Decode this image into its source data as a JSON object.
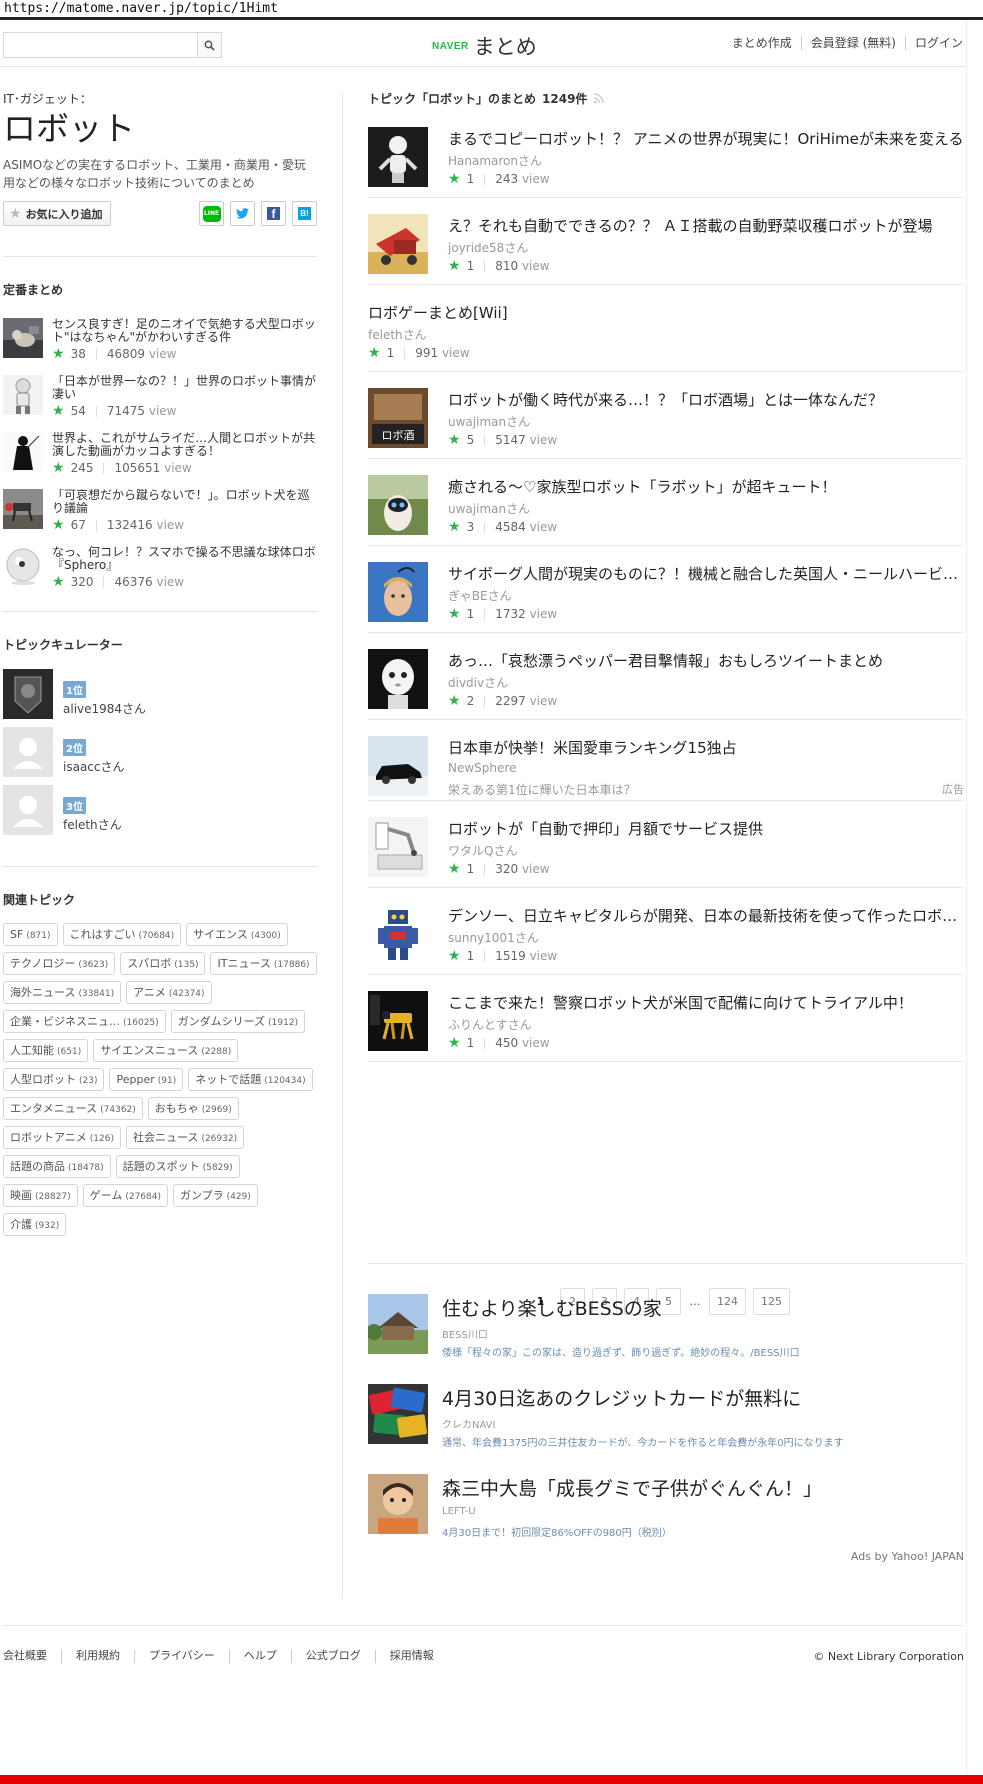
{
  "url": "https://matome.naver.jp/topic/1Himt",
  "header": {
    "search_placeholder": "",
    "logo_brand": "NAVER",
    "logo_text": "まとめ",
    "links": [
      "まとめ作成",
      "会員登録 (無料)",
      "ログイン"
    ]
  },
  "topic": {
    "category": "IT･ガジェット：",
    "title": "ロボット",
    "description": "ASIMOなどの実在するロボット、工業用・商業用・愛玩用などの様々なロボット技術についてのまとめ",
    "favorite_label": "お気に入り追加",
    "share": [
      "LINE",
      "Twitter",
      "Facebook",
      "はてなブックマーク"
    ]
  },
  "teiban": {
    "heading": "定番まとめ",
    "items": [
      {
        "title": "センス良すぎ！足のニオイで気絶する犬型ロボット\"はなちゃん\"がかわいすぎる件",
        "stars": "38",
        "views": "46809"
      },
      {
        "title": "「日本が世界一なの？！」世界のロボット事情が凄い",
        "stars": "54",
        "views": "71475"
      },
      {
        "title": "世界よ、これがサムライだ…人間とロボットが共演した動画がカッコよすぎる！",
        "stars": "245",
        "views": "105651"
      },
      {
        "title": "「可哀想だから蹴らないで！」。ロボット犬を巡り議論",
        "stars": "67",
        "views": "132416"
      },
      {
        "title": "なっ、何コレ！？スマホで操る不思議な球体ロボ『Sphero』",
        "stars": "320",
        "views": "46376"
      }
    ]
  },
  "curators": {
    "heading": "トピックキュレーター",
    "items": [
      {
        "rank": "1位",
        "name": "alive1984さん"
      },
      {
        "rank": "2位",
        "name": "isaaccさん"
      },
      {
        "rank": "3位",
        "name": "felethさん"
      }
    ]
  },
  "related": {
    "heading": "関連トピック",
    "tags": [
      {
        "name": "SF",
        "count": "(871)"
      },
      {
        "name": "これはすごい",
        "count": "(70684)"
      },
      {
        "name": "サイエンス",
        "count": "(4300)"
      },
      {
        "name": "テクノロジー",
        "count": "(3623)"
      },
      {
        "name": "スパロボ",
        "count": "(135)"
      },
      {
        "name": "ITニュース",
        "count": "(17886)"
      },
      {
        "name": "海外ニュース",
        "count": "(33841)"
      },
      {
        "name": "アニメ",
        "count": "(42374)"
      },
      {
        "name": "企業・ビジネスニュ…",
        "count": "(16025)"
      },
      {
        "name": "ガンダムシリーズ",
        "count": "(1912)"
      },
      {
        "name": "人工知能",
        "count": "(651)"
      },
      {
        "name": "サイエンスニュース",
        "count": "(2288)"
      },
      {
        "name": "人型ロボット",
        "count": "(23)"
      },
      {
        "name": "Pepper",
        "count": "(91)"
      },
      {
        "name": "ネットで話題",
        "count": "(120434)"
      },
      {
        "name": "エンタメニュース",
        "count": "(74362)"
      },
      {
        "name": "おもちゃ",
        "count": "(2969)"
      },
      {
        "name": "ロボットアニメ",
        "count": "(126)"
      },
      {
        "name": "社会ニュース",
        "count": "(26932)"
      },
      {
        "name": "話題の商品",
        "count": "(18478)"
      },
      {
        "name": "話題のスポット",
        "count": "(5829)"
      },
      {
        "name": "映画",
        "count": "(28827)"
      },
      {
        "name": "ゲーム",
        "count": "(27684)"
      },
      {
        "name": "ガンプラ",
        "count": "(429)"
      },
      {
        "name": "介護",
        "count": "(932)"
      }
    ]
  },
  "main": {
    "heading": "トピック「ロボット」のまとめ",
    "count": "1249件",
    "view_suffix": "view",
    "items": [
      {
        "title": "まるでコピーロボット！？ アニメの世界が現実に！OriHimeが未来を変える",
        "author": "Hanamaronさん",
        "stars": "1",
        "views": "243",
        "thumb": "robot-white"
      },
      {
        "title": "え？それも自動でできるの？？ ＡＩ搭載の自動野菜収穫ロボットが登場",
        "author": "joyride58さん",
        "stars": "1",
        "views": "810",
        "thumb": "harvester"
      },
      {
        "title": "ロボゲーまとめ[Wii]",
        "author": "felethさん",
        "stars": "1",
        "views": "991",
        "thumb": ""
      },
      {
        "title": "ロボットが働く時代が来る…！？「ロボ酒場」とは一体なんだ？",
        "author": "uwajimanさん",
        "stars": "5",
        "views": "5147",
        "thumb": "robo-bar"
      },
      {
        "title": "癒される〜♡家族型ロボット「ラボット」が超キュート！",
        "author": "uwajimanさん",
        "stars": "3",
        "views": "4584",
        "thumb": "lovot"
      },
      {
        "title": "サイボーグ人間が現実のものに？！機械と融合した英国人・ニールハービソン",
        "author": "ぎゃBEさん",
        "stars": "1",
        "views": "1732",
        "thumb": "cyborg"
      },
      {
        "title": "あっ…「哀愁漂うペッパー君目撃情報」おもしろツイートまとめ",
        "author": "divdivさん",
        "stars": "2",
        "views": "2297",
        "thumb": "pepper"
      },
      {
        "title": "日本車が快挙！米国愛車ランキング15独占",
        "author": "NewSphere",
        "sub": "栄えある第1位に輝いた日本車は？",
        "ad": "広告",
        "thumb": "car"
      },
      {
        "title": "ロボットが「自動で押印」月額でサービス提供",
        "author": "ワタルQさん",
        "stars": "1",
        "views": "320",
        "thumb": "stamp-robot"
      },
      {
        "title": "デンソー、日立キャピタルらが開発、日本の最新技術を使って作ったロボットたち",
        "author": "sunny1001さん",
        "stars": "1",
        "views": "1519",
        "thumb": "toy-robot"
      },
      {
        "title": "ここまで来た！警察ロボット犬が米国で配備に向けてトライアル中！",
        "author": "ふりんとすさん",
        "stars": "1",
        "views": "450",
        "thumb": "robot-dog"
      }
    ]
  },
  "pagination": [
    "1",
    "2",
    "3",
    "4",
    "5",
    "…",
    "124",
    "125"
  ],
  "ads": [
    {
      "title": "住むより楽しむBESSの家",
      "source": "BESS川口",
      "desc": "倭様「程々の家」この家は、造り過ぎず、飾り過ぎず。絶妙の程々。/BESS川口"
    },
    {
      "title": "4月30日迄あのクレジットカードが無料に",
      "source": "クレカNAVI",
      "desc": "通常、年会費1375円の三井住友カードが、今カードを作ると年会費が永年0円になります"
    },
    {
      "title": "森三中大島「成長グミで子供がぐんぐん！」",
      "source": "LEFT-U",
      "desc": "4月30日まで！初回限定86%OFFの980円（税別）"
    }
  ],
  "ads_credit": "Ads by Yahoo! JAPAN",
  "footer": {
    "links": [
      "会社概要",
      "利用規約",
      "プライバシー",
      "ヘルプ",
      "公式ブログ",
      "採用情報"
    ],
    "copyright": "© Next Library Corporation"
  },
  "colors": {
    "star": "#2db34a",
    "naver_green": "#1fbe3a",
    "rank_badge": "#79a9d1",
    "bottom_bar": "#e50000"
  }
}
